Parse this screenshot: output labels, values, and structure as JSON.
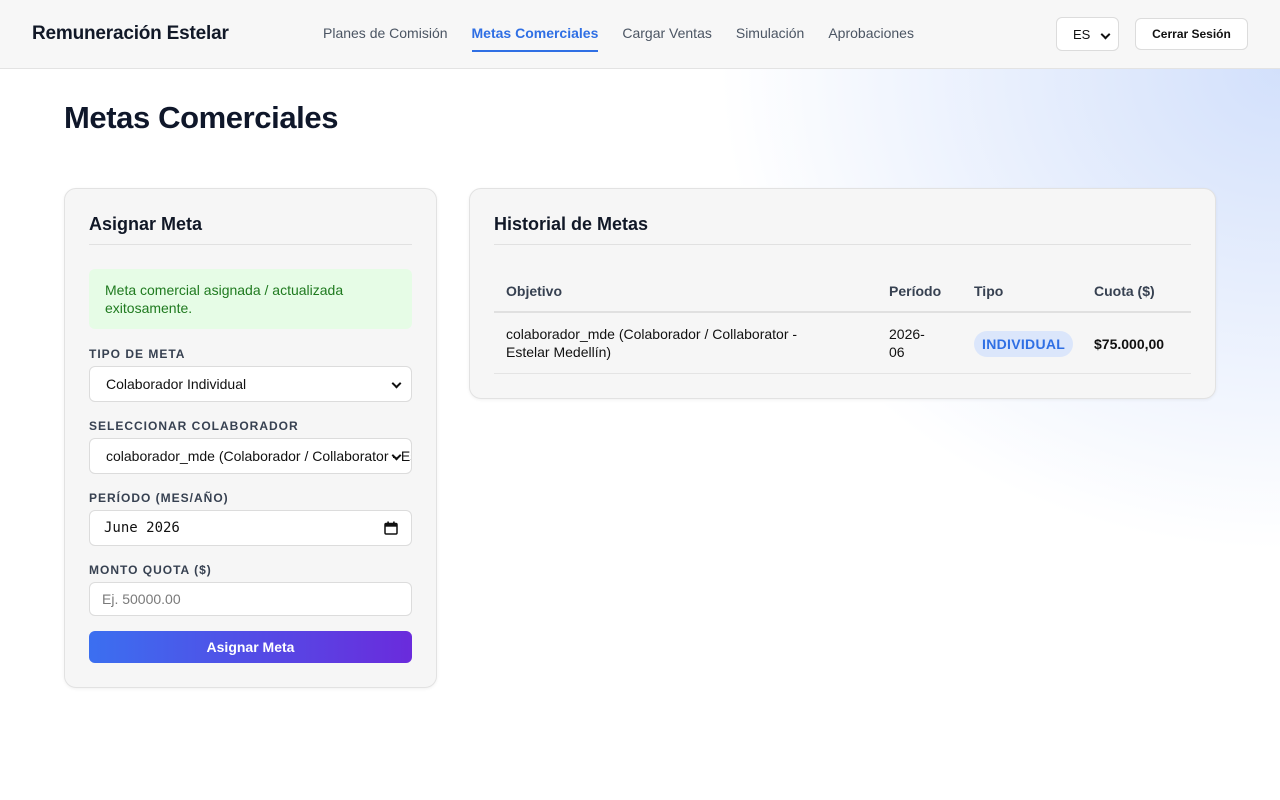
{
  "header": {
    "brand": "Remuneración Estelar",
    "nav": [
      {
        "label": "Planes de Comisión",
        "active": false
      },
      {
        "label": "Metas Comerciales",
        "active": true
      },
      {
        "label": "Cargar Ventas",
        "active": false
      },
      {
        "label": "Simulación",
        "active": false
      },
      {
        "label": "Aprobaciones",
        "active": false
      }
    ],
    "language": "ES",
    "logout_label": "Cerrar Sesión"
  },
  "page": {
    "title": "Metas Comerciales"
  },
  "assign_form": {
    "title": "Asignar Meta",
    "success_message": "Meta comercial asignada / actualizada exitosamente.",
    "goal_type": {
      "label": "TIPO DE META",
      "value": "Colaborador Individual"
    },
    "collaborator": {
      "label": "SELECCIONAR COLABORADOR",
      "value": "colaborador_mde (Colaborador / Collaborator - Estelar Medellín)"
    },
    "period": {
      "label": "PERÍODO (MES/AÑO)",
      "value": "June 2026"
    },
    "quota": {
      "label": "MONTO QUOTA ($)",
      "value": "",
      "placeholder": "Ej. 50000.00"
    },
    "submit_label": "Asignar Meta"
  },
  "history": {
    "title": "Historial de Metas",
    "columns": [
      "Objetivo",
      "Período",
      "Tipo",
      "Cuota ($)"
    ],
    "rows": [
      {
        "objective_line1": "colaborador_mde (Colaborador / Collaborator -",
        "objective_line2": "Estelar Medellín)",
        "period_line1": "2026-",
        "period_line2": "06",
        "type": "INDIVIDUAL",
        "quota": "$75.000,00"
      }
    ]
  },
  "colors": {
    "accent": "#2f6fe4",
    "success_bg": "#e6fce6",
    "success_text": "#1f7a1f",
    "button_gradient_start": "#3b6ff0",
    "button_gradient_end": "#6a2bdc"
  }
}
